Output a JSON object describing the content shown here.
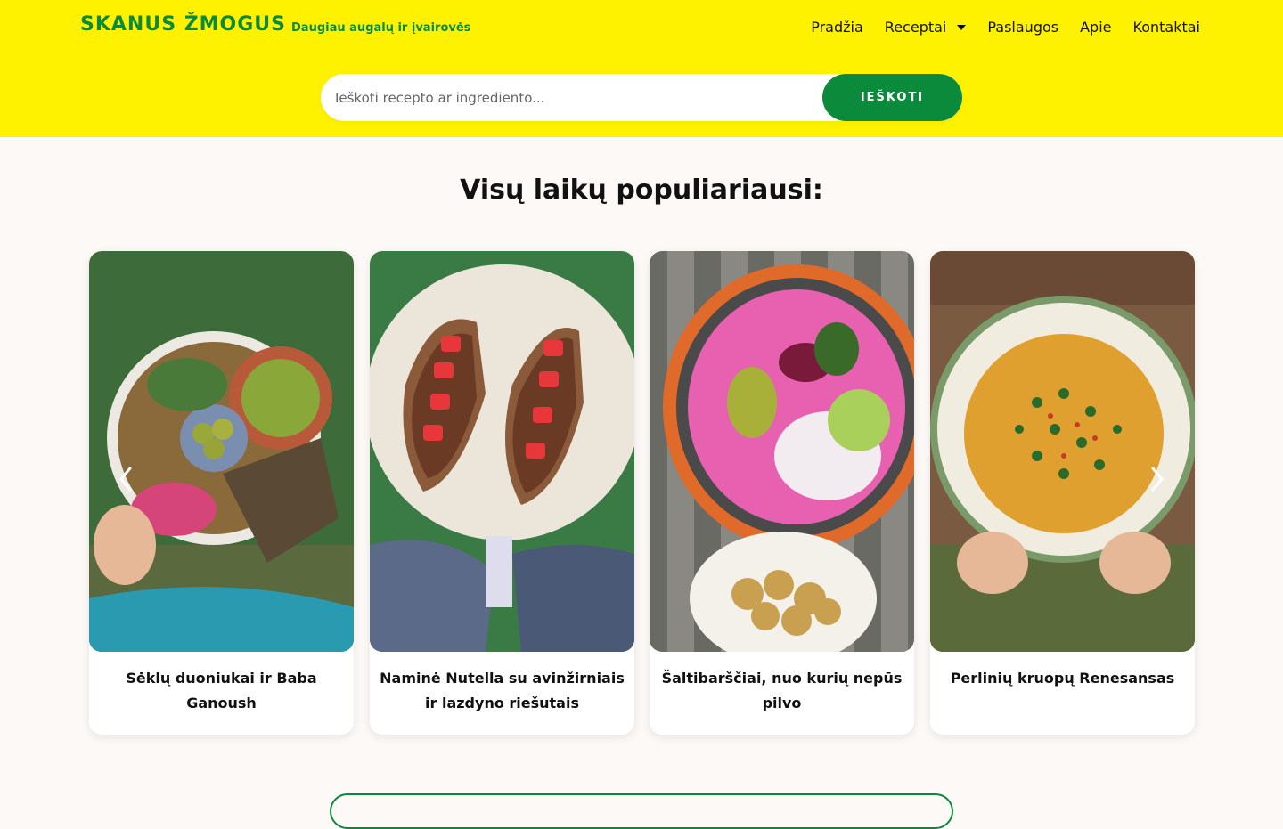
{
  "header": {
    "logo": "SKANUS ŽMOGUS",
    "tagline": "Daugiau augalų ir įvairovės",
    "nav": [
      {
        "label": "Pradžia"
      },
      {
        "label": "Receptai",
        "has_dropdown": true
      },
      {
        "label": "Paslaugos"
      },
      {
        "label": "Apie"
      },
      {
        "label": "Kontaktai"
      }
    ]
  },
  "search": {
    "placeholder": "Ieškoti recepto ar ingrediento...",
    "button_label": "IEŠKOTI"
  },
  "section": {
    "title": "Visų laikų populiariausi:"
  },
  "cards": [
    {
      "title": "Sėklų duoniukai ir Baba Ganoush",
      "icon": "food-photo"
    },
    {
      "title": "Naminė Nutella su avinžirniais ir lazdyno riešutais",
      "icon": "food-photo"
    },
    {
      "title": "Šaltibarščiai, nuo kurių nepūs pilvo",
      "icon": "food-photo"
    },
    {
      "title": "Perlinių kruopų Renesansas",
      "icon": "food-photo"
    }
  ],
  "carousel": {
    "prev_icon": "chevron-left-icon",
    "next_icon": "chevron-right-icon"
  },
  "colors": {
    "header_bg": "#fff200",
    "brand_green": "#0a8a3a",
    "page_bg": "#fcf9f6"
  }
}
